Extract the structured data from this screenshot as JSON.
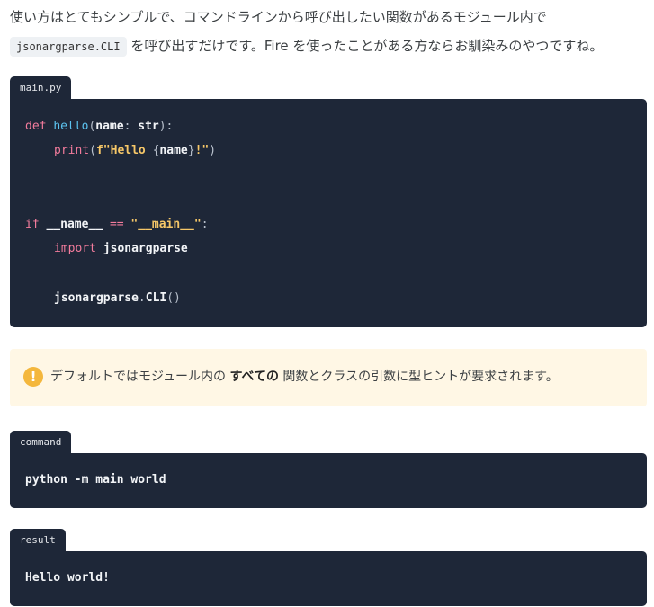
{
  "intro": {
    "line1": "使い方はとてもシンプルで、コマンドラインから呼び出したい関数があるモジュール内で",
    "code": "jsonargparse.CLI",
    "line2_after_code": "を呼び出すだけです。Fire を使ったことがある方ならお馴染みのやつですね。"
  },
  "main_block": {
    "label": "main.py",
    "l1": {
      "kw": "def",
      "fn": "hello",
      "p1": "(",
      "arg": "name",
      "p2": ": ",
      "type": "str",
      "p3": "):"
    },
    "l2": {
      "fn": "print",
      "p1": "(",
      "str1": "f\"Hello ",
      "brace1": "{",
      "arg": "name",
      "brace2": "}",
      "str2": "!\"",
      "p2": ")"
    },
    "l3": {
      "kw": "if",
      "name": "__name__",
      "op": "==",
      "str": "\"__main__\"",
      "colon": ":"
    },
    "l4": {
      "kw": "import",
      "mod": "jsonargparse"
    },
    "l5": {
      "obj": "jsonargparse",
      "dot": ".",
      "call": "CLI",
      "paren": "()"
    }
  },
  "note": {
    "icon": "exclamation-icon",
    "before": "デフォルトではモジュール内の",
    "bold": "すべての",
    "after": "関数とクラスの引数に型ヒントが要求されます。"
  },
  "command_block": {
    "label": "command",
    "line": "python -m main world"
  },
  "result_block": {
    "label": "result",
    "line": "Hello world!"
  }
}
